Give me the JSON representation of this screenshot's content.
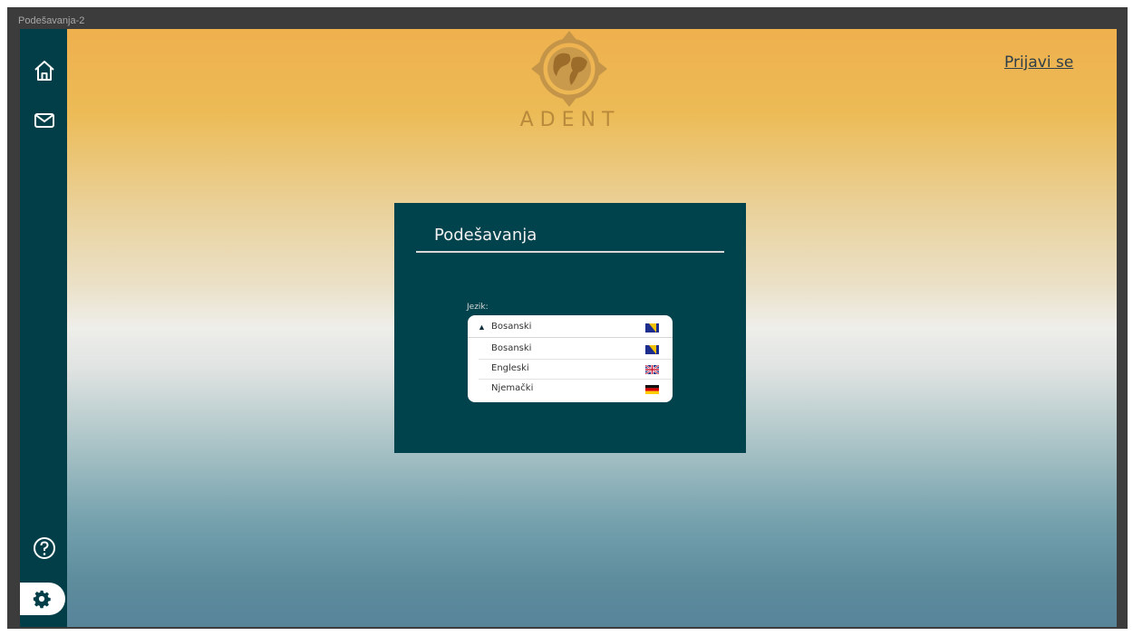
{
  "window": {
    "title": "Podešavanja-2"
  },
  "sidebar": {
    "home_icon": "home-icon",
    "mail_icon": "mail-icon",
    "help_icon": "help-icon",
    "settings_icon": "gear-icon"
  },
  "header": {
    "logo_text": "ADENT",
    "login_label": "Prijavi se"
  },
  "settings_panel": {
    "title": "Podešavanja",
    "language_label": "Jezik:",
    "selected": {
      "label": "Bosanski",
      "flag": "flag-ba-icon"
    },
    "options": [
      {
        "label": "Bosanski",
        "flag": "flag-ba-icon"
      },
      {
        "label": "Engleski",
        "flag": "flag-gb-icon"
      },
      {
        "label": "Njemački",
        "flag": "flag-de-icon"
      }
    ]
  },
  "colors": {
    "sidebar": "#013e48",
    "panel": "#01434d",
    "logo_gold": "#b98a3b"
  }
}
